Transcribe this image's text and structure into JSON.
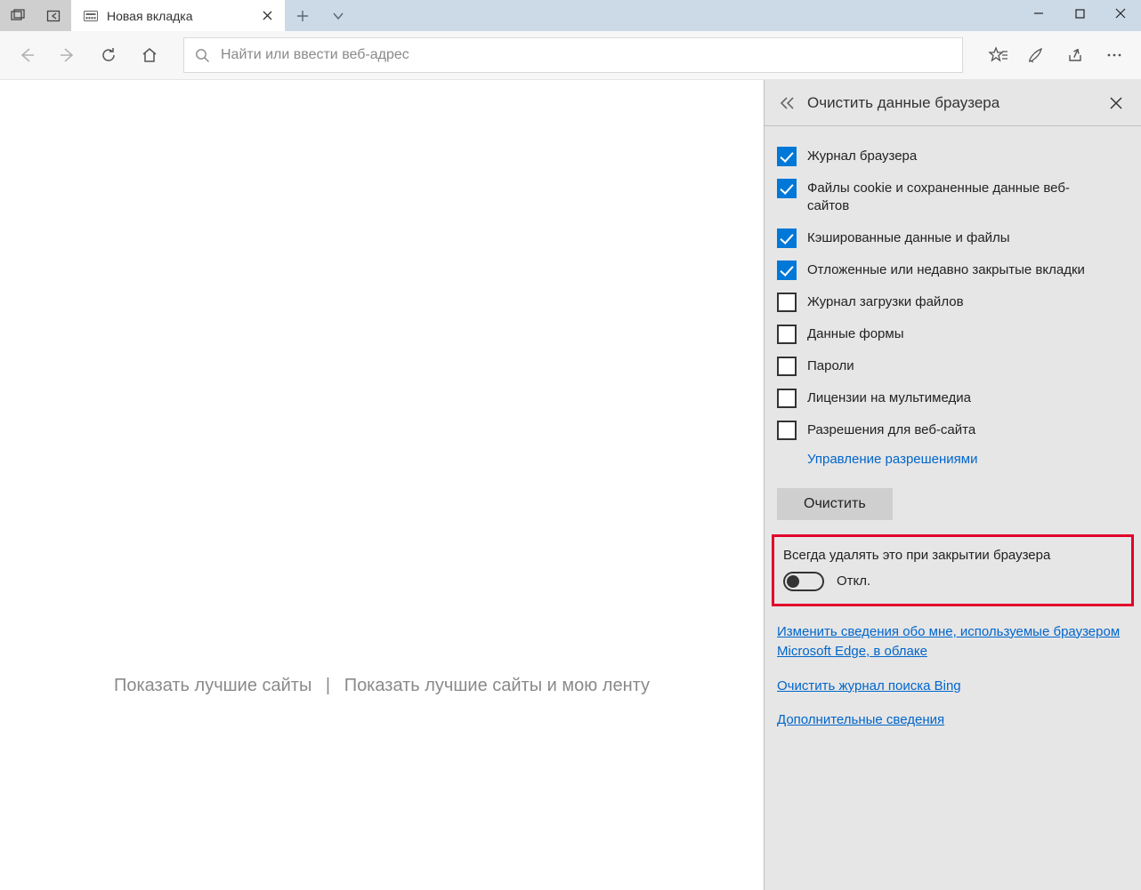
{
  "tab": {
    "title": "Новая вкладка"
  },
  "urlbar": {
    "placeholder": "Найти или ввести веб-адрес"
  },
  "page": {
    "link_best": "Показать лучшие сайты",
    "link_best_feed": "Показать лучшие сайты и мою ленту"
  },
  "panel": {
    "title": "Очистить данные браузера",
    "items": [
      {
        "label": "Журнал браузера",
        "checked": true
      },
      {
        "label": "Файлы cookie и сохраненные данные веб-сайтов",
        "checked": true
      },
      {
        "label": "Кэшированные данные и файлы",
        "checked": true
      },
      {
        "label": "Отложенные или недавно закрытые вкладки",
        "checked": true
      },
      {
        "label": "Журнал загрузки файлов",
        "checked": false
      },
      {
        "label": "Данные формы",
        "checked": false
      },
      {
        "label": "Пароли",
        "checked": false
      },
      {
        "label": "Лицензии на мультимедиа",
        "checked": false
      },
      {
        "label": "Разрешения для веб-сайта",
        "checked": false
      }
    ],
    "manage_permissions": "Управление разрешениями",
    "clear_button": "Очистить",
    "always_clear_title": "Всегда удалять это при закрытии браузера",
    "toggle_state": "Откл.",
    "link_cloud": "Изменить сведения обо мне, используемые браузером Microsoft Edge, в облаке",
    "link_bing": "Очистить журнал поиска Bing",
    "link_more": "Дополнительные сведения"
  }
}
